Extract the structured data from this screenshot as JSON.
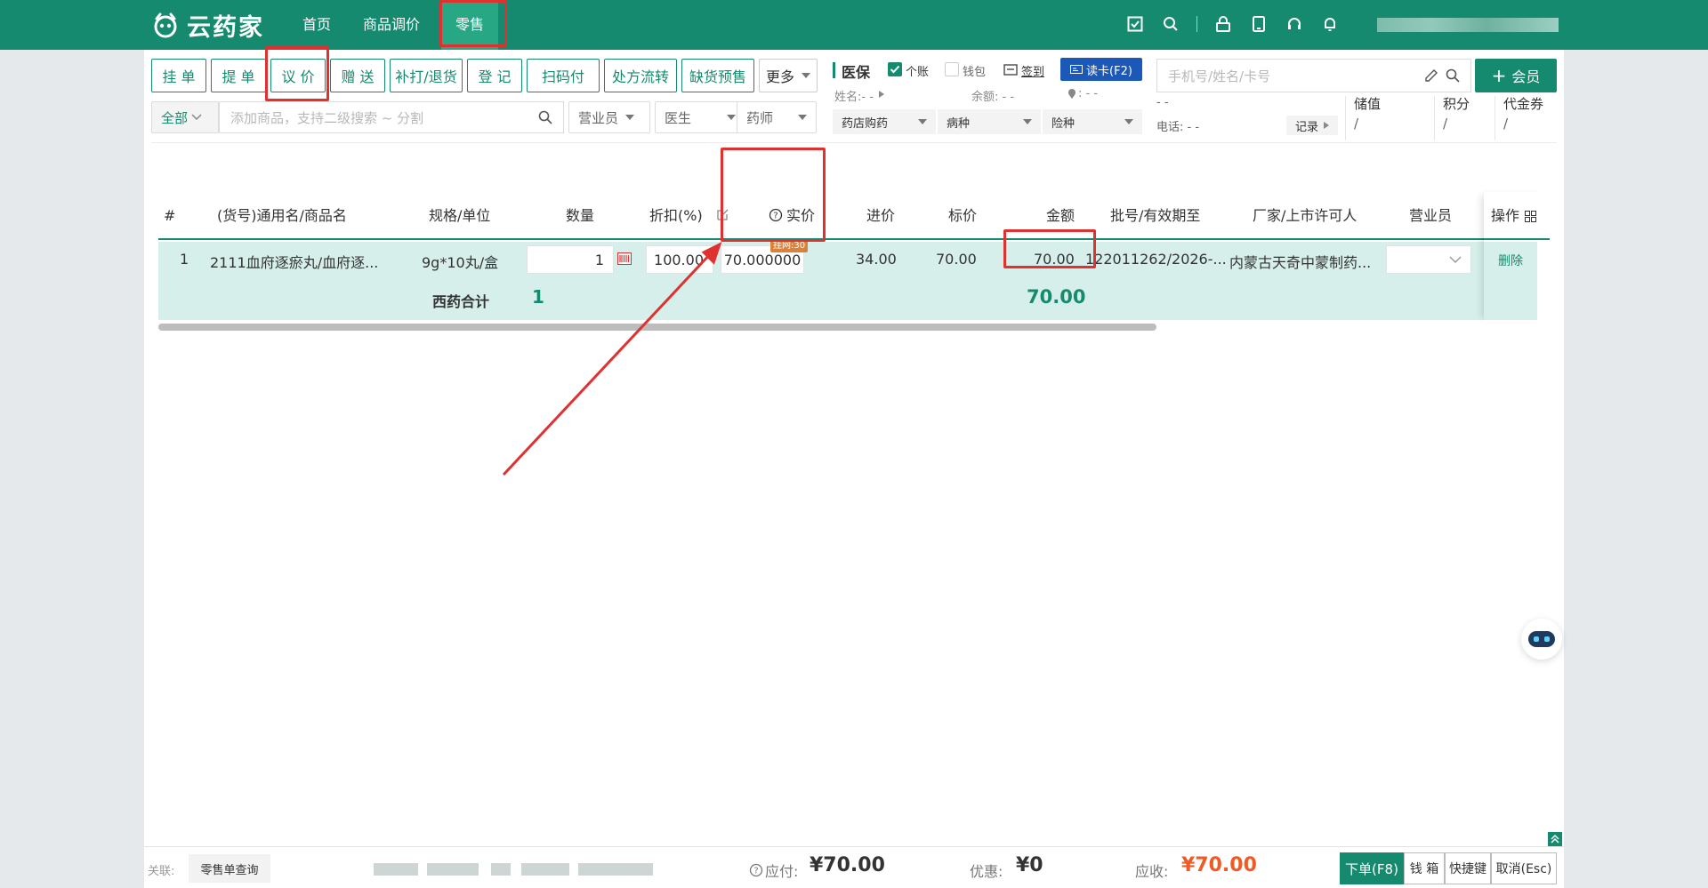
{
  "app": {
    "logo_text": "云药家"
  },
  "nav": {
    "items": [
      {
        "label": "首页"
      },
      {
        "label": "商品调价"
      },
      {
        "label": "零售"
      }
    ]
  },
  "toolbar": {
    "buttons": [
      "挂 单",
      "提 单",
      "议 价",
      "赠 送",
      "补打/退货",
      "登 记",
      "扫码付",
      "处方流转",
      "缺货预售"
    ],
    "more_label": "更多"
  },
  "search": {
    "category": "全部",
    "placeholder": "添加商品，支持二级搜索 ~ 分割",
    "sales_label": "营业员",
    "doctor_label": "医生",
    "pharmacist_label": "药师"
  },
  "insurance": {
    "title": "医保",
    "personal_account": "个账",
    "wallet": "钱包",
    "sign_in": "签到",
    "read_card": "读卡(F2)",
    "name_label": "姓名:- -",
    "balance_label": "余额: - -",
    "location_label": ": - -",
    "purchase_type": "药店购药",
    "disease": "病种",
    "insurance_type": "险种"
  },
  "member": {
    "placeholder": "手机号/姓名/卡号",
    "add_label": "会员",
    "name_value": "- -",
    "phone_label": "电话: - -",
    "record_label": "记录",
    "stored_value_label": "储值",
    "stored_value": "/",
    "points_label": "积分",
    "points": "/",
    "coupon_label": "代金券",
    "coupon": "/"
  },
  "table": {
    "headers": {
      "index": "#",
      "name": "(货号)通用名/商品名",
      "spec": "规格/单位",
      "qty": "数量",
      "discount": "折扣(%)",
      "price": "实价",
      "cost": "进价",
      "list_price": "标价",
      "amount": "金额",
      "batch": "批号/有效期至",
      "maker": "厂家/上市许可人",
      "sales": "营业员",
      "ops": "操作"
    },
    "row": {
      "index": "1",
      "name": "2111血府逐瘀丸/血府逐...",
      "spec": "9g*10丸/盒",
      "qty": "1",
      "discount": "100.00",
      "price": "70.000000",
      "price_tag": "挂网:30",
      "cost": "34.00",
      "list_price": "70.00",
      "amount": "70.00",
      "batch": "122011262/2026-...",
      "maker": "内蒙古天奇中蒙制药...",
      "delete": "删除"
    },
    "subtotal": {
      "label": "西药合计",
      "qty": "1",
      "amount": "70.00"
    }
  },
  "bottom": {
    "link_label": "关联:",
    "query_button": "零售单查询",
    "payable_label": "应付:",
    "payable": "¥70.00",
    "discount_label": "优惠:",
    "discount": "¥0",
    "receivable_label": "应收:",
    "receivable": "¥70.00",
    "buttons": [
      "下单(F8)",
      "钱 箱",
      "快捷键",
      "取消(Esc)"
    ]
  },
  "colors": {
    "brand": "#168a6e",
    "accent_red": "#e03131",
    "amount_orange": "#f05a24"
  }
}
